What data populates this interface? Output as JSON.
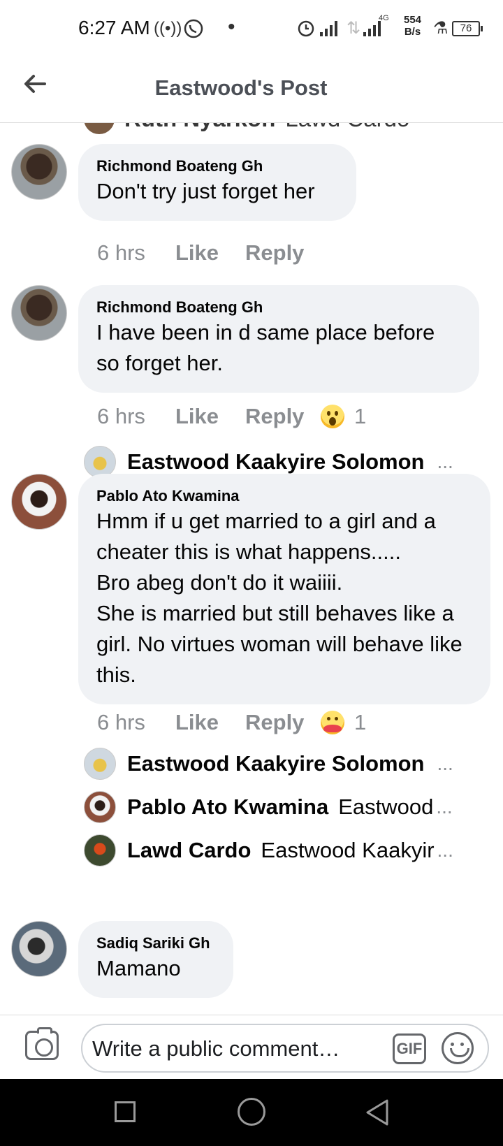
{
  "status_bar": {
    "time": "6:27 AM",
    "network": "4G",
    "speed_value": "554",
    "speed_unit": "B/s",
    "battery": "76"
  },
  "header": {
    "title": "Eastwood's Post",
    "back_icon": "arrow-left-icon"
  },
  "peek_reply": {
    "name": "Ruth Nyarkoh",
    "text": "Lawd Cardo"
  },
  "comments": [
    {
      "author": "Richmond Boateng Gh",
      "text": "Don't try just forget her",
      "time": "6 hrs",
      "like_label": "Like",
      "reply_label": "Reply"
    },
    {
      "author": "Richmond Boateng Gh",
      "text": "I have been in d same place before so forget her.",
      "time": "6 hrs",
      "like_label": "Like",
      "reply_label": "Reply",
      "reaction": "wow",
      "reaction_count": "1",
      "replies": [
        {
          "name": "Eastwood Kaakyire Solomon",
          "text": ""
        }
      ]
    },
    {
      "author": "Pablo Ato Kwamina",
      "text": "Hmm if u get married to a girl and a cheater this is what happens.....\nBro abeg don't do it waiiii.\nShe is married but still behaves like a girl. No virtues woman will behave like this.",
      "time": "6 hrs",
      "like_label": "Like",
      "reply_label": "Reply",
      "reaction": "care",
      "reaction_count": "1",
      "replies": [
        {
          "name": "Eastwood Kaakyire Solomon",
          "text": ""
        },
        {
          "name": "Pablo Ato Kwamina",
          "text": "Eastwood"
        },
        {
          "name": "Lawd Cardo",
          "text": "Eastwood Kaakyir"
        }
      ]
    },
    {
      "author": "Sadiq Sariki Gh",
      "text": "Mamano"
    }
  ],
  "ellipsis": "...",
  "composer": {
    "placeholder": "Write a public comment…",
    "gif_label": "GIF"
  }
}
